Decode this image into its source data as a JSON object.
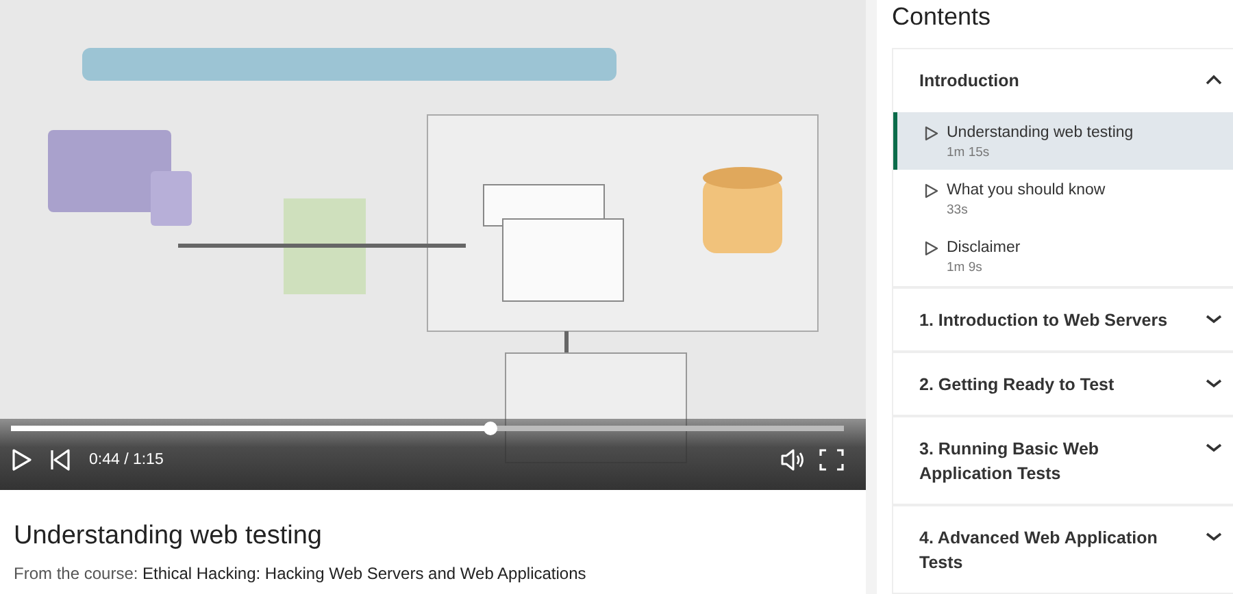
{
  "player": {
    "progress": {
      "level": 0.575
    },
    "time": "0:44 / 1:15"
  },
  "video_info": {
    "title": "Understanding web testing",
    "course_label": "From the course:",
    "course_name": "Ethical Hacking: Hacking Web Servers and Web Applications"
  },
  "contents": {
    "heading": "Contents",
    "sections": [
      {
        "title": "Introduction",
        "expanded": true,
        "items": [
          {
            "title": "Understanding web testing",
            "duration": "1m 15s",
            "selected": true
          },
          {
            "title": "What you should know",
            "duration": "33s",
            "selected": false
          },
          {
            "title": "Disclaimer",
            "duration": "1m 9s",
            "selected": false
          }
        ]
      },
      {
        "title": "1. Introduction to Web Servers",
        "expanded": false
      },
      {
        "title": "2. Getting Ready to Test",
        "expanded": false
      },
      {
        "title": "3. Running Basic Web Application Tests",
        "expanded": false
      },
      {
        "title": "4. Advanced Web Application Tests",
        "expanded": false
      }
    ]
  }
}
